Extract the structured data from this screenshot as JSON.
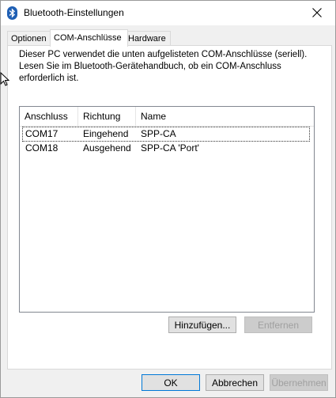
{
  "window": {
    "title": "Bluetooth-Einstellungen"
  },
  "icons": {
    "app": "bluetooth-icon",
    "close": "close-icon",
    "cursor": "mouse-pointer-icon"
  },
  "tabs": [
    {
      "label": "Optionen"
    },
    {
      "label": "COM-Anschlüsse"
    },
    {
      "label": "Hardware"
    }
  ],
  "description": {
    "line1": "Dieser PC verwendet die unten aufgelisteten COM-Anschlüsse (seriell).",
    "line2": "Lesen Sie im Bluetooth-Gerätehandbuch, ob ein COM-Anschluss",
    "line3": "erforderlich ist."
  },
  "table": {
    "headers": {
      "port": "Anschluss",
      "direction": "Richtung",
      "name": "Name"
    },
    "rows": [
      {
        "port": "COM17",
        "direction": "Eingehend",
        "name": "SPP-CA"
      },
      {
        "port": "COM18",
        "direction": "Ausgehend",
        "name": "SPP-CA 'Port'"
      }
    ]
  },
  "buttons": {
    "add": "Hinzufügen...",
    "remove": "Entfernen",
    "ok": "OK",
    "cancel": "Abbrechen",
    "apply": "Übernehmen"
  }
}
